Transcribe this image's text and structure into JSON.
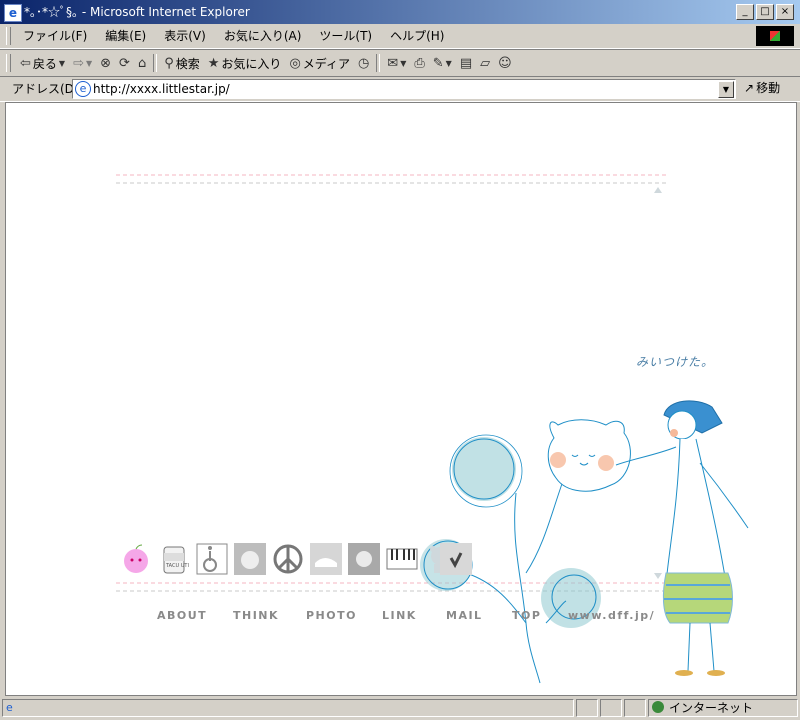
{
  "window": {
    "title": "*｡･*☆ﾟ§｡ - Microsoft Internet Explorer",
    "buttons": {
      "minimize": "_",
      "maximize": "□",
      "close": "×"
    }
  },
  "menu": {
    "items": [
      "ファイル(F)",
      "編集(E)",
      "表示(V)",
      "お気に入り(A)",
      "ツール(T)",
      "ヘルプ(H)"
    ]
  },
  "toolbar": {
    "back": "戻る",
    "search": "検索",
    "favorites": "お気に入り",
    "media": "メディア"
  },
  "address": {
    "label": "アドレス(D)",
    "url": "http://xxxx.littlestar.jp/",
    "go": "移動"
  },
  "page": {
    "caption": "みいつけた。",
    "nav": [
      "ABOUT",
      "THINK",
      "PHOTO",
      "LINK",
      "MAIL",
      "TOP",
      "www.dff.jp/"
    ],
    "icon_badge": "TACU UTI"
  },
  "status": {
    "zone": "インターネット"
  },
  "colors": {
    "title_start": "#0a246a",
    "title_end": "#a6caf0",
    "pink_dash": "#f4b6c2",
    "nav_gray": "#8a8a8a",
    "art_blue": "#1f8fc7",
    "art_teal": "#8ec8cf"
  }
}
